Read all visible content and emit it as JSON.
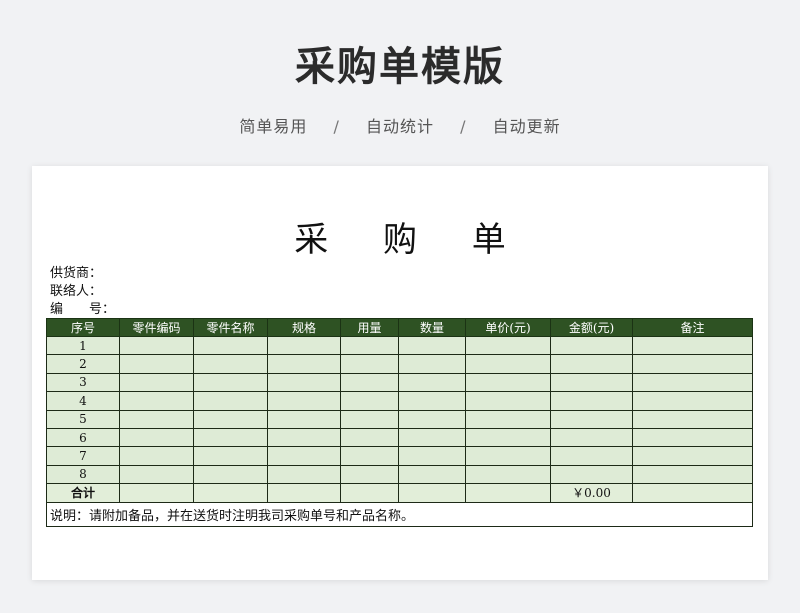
{
  "header": {
    "title": "采购单模版",
    "features": [
      "简单易用",
      "自动统计",
      "自动更新"
    ],
    "separator": "/"
  },
  "sheet": {
    "title": "采 购 单",
    "supplier_label": "供货商：",
    "contact_label": "联络人：",
    "number_label": "编　　号："
  },
  "table": {
    "columns": [
      "序号",
      "零件编码",
      "零件名称",
      "规格",
      "用量",
      "数量",
      "单价(元)",
      "金额(元)",
      "备注"
    ],
    "rows": [
      "1",
      "2",
      "3",
      "4",
      "5",
      "6",
      "7",
      "8"
    ],
    "total_label": "合计",
    "total_amount": "￥0.00",
    "note": "说明：请附加备品，并在送货时注明我司采购单号和产品名称。"
  },
  "colors": {
    "header_bg": "#2e5223",
    "cell_bg": "#deebd6",
    "page_bg": "#f1f2f4"
  }
}
